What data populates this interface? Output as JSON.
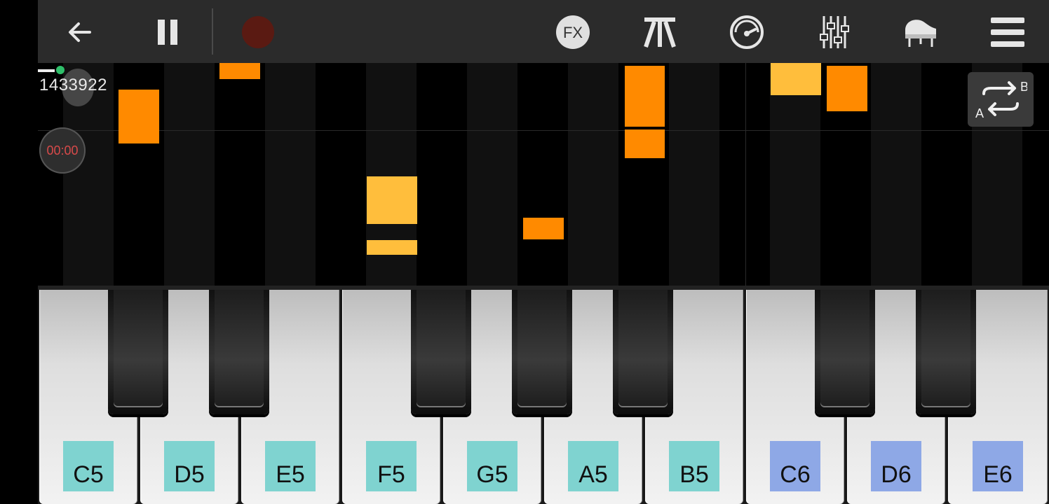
{
  "toolbar": {
    "buttons": [
      {
        "name": "back-arrow-icon"
      },
      {
        "name": "pause-icon"
      },
      {
        "name": "record-icon"
      },
      {
        "name": "fx-icon",
        "label": "FX"
      },
      {
        "name": "metronome-icon"
      },
      {
        "name": "tempo-gauge-icon"
      },
      {
        "name": "mixer-sliders-icon"
      },
      {
        "name": "grand-piano-icon"
      },
      {
        "name": "menu-icon"
      }
    ],
    "record_color": "#5a1a12"
  },
  "overlay": {
    "user_id": "1433922",
    "timer": "00:00",
    "ab_loop": {
      "a": "A",
      "b": "B"
    }
  },
  "colors": {
    "note_orange": "#ff8a00",
    "note_yellow": "#ffbe3c",
    "label_teal": "#7fd3d0",
    "label_blue": "#8ea8e6",
    "timer_red": "#d84a4a"
  },
  "keyboard": {
    "white_keys": [
      {
        "label": "C5",
        "octave_color": "teal"
      },
      {
        "label": "D5",
        "octave_color": "teal"
      },
      {
        "label": "E5",
        "octave_color": "teal"
      },
      {
        "label": "F5",
        "octave_color": "teal"
      },
      {
        "label": "G5",
        "octave_color": "teal"
      },
      {
        "label": "A5",
        "octave_color": "teal"
      },
      {
        "label": "B5",
        "octave_color": "teal"
      },
      {
        "label": "C6",
        "octave_color": "blue"
      },
      {
        "label": "D6",
        "octave_color": "blue"
      },
      {
        "label": "E6",
        "octave_color": "blue"
      }
    ]
  }
}
